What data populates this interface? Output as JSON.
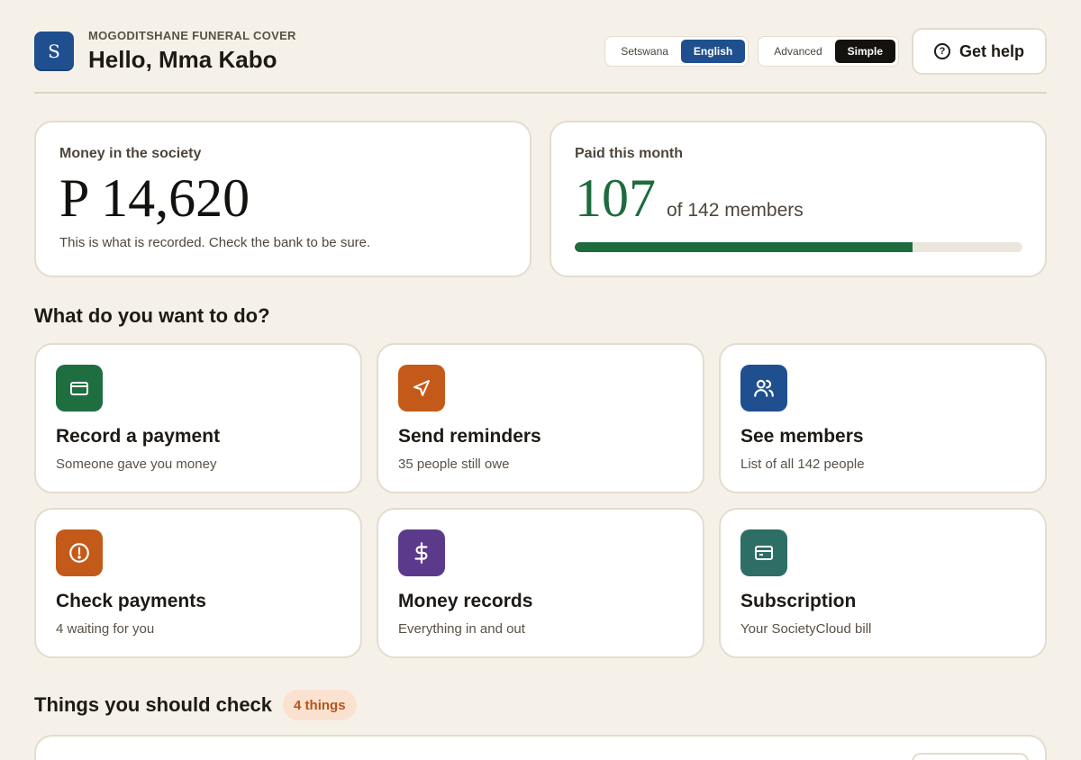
{
  "header": {
    "avatar_letter": "S",
    "society_name": "MOGODITSHANE FUNERAL COVER",
    "greeting": "Hello, Mma Kabo",
    "language_toggle": [
      "Setswana",
      "English"
    ],
    "language_selected": "English",
    "mode_toggle": [
      "Advanced",
      "Simple"
    ],
    "mode_selected": "Simple",
    "help_label": "Get help"
  },
  "stats": {
    "money": {
      "label": "Money in the society",
      "amount": "P 14,620",
      "note": "This is what is recorded. Check the bank to be sure."
    },
    "paid": {
      "label": "Paid this month",
      "count": "107",
      "of_text": "of 142 members",
      "paid_count": 107,
      "total_members": 142
    }
  },
  "actions_title": "What do you want to do?",
  "actions": [
    {
      "title": "Record a payment",
      "subtitle": "Someone gave you money",
      "icon": "card-icon",
      "color": "#1f6e3f"
    },
    {
      "title": "Send reminders",
      "subtitle": "35 people still owe",
      "icon": "send-icon",
      "color": "#c45a19"
    },
    {
      "title": "See members",
      "subtitle": "List of all 142 people",
      "icon": "users-icon",
      "color": "#1f4f8f"
    },
    {
      "title": "Check payments",
      "subtitle": "4 waiting for you",
      "icon": "alert-icon",
      "color": "#c45a19"
    },
    {
      "title": "Money records",
      "subtitle": "Everything in and out",
      "icon": "dollar-icon",
      "color": "#5b3a8c"
    },
    {
      "title": "Subscription",
      "subtitle": "Your SocietyCloud bill",
      "icon": "billing-icon",
      "color": "#2d6e66"
    }
  ],
  "checks": {
    "title": "Things you should check",
    "badge": "4 things"
  }
}
